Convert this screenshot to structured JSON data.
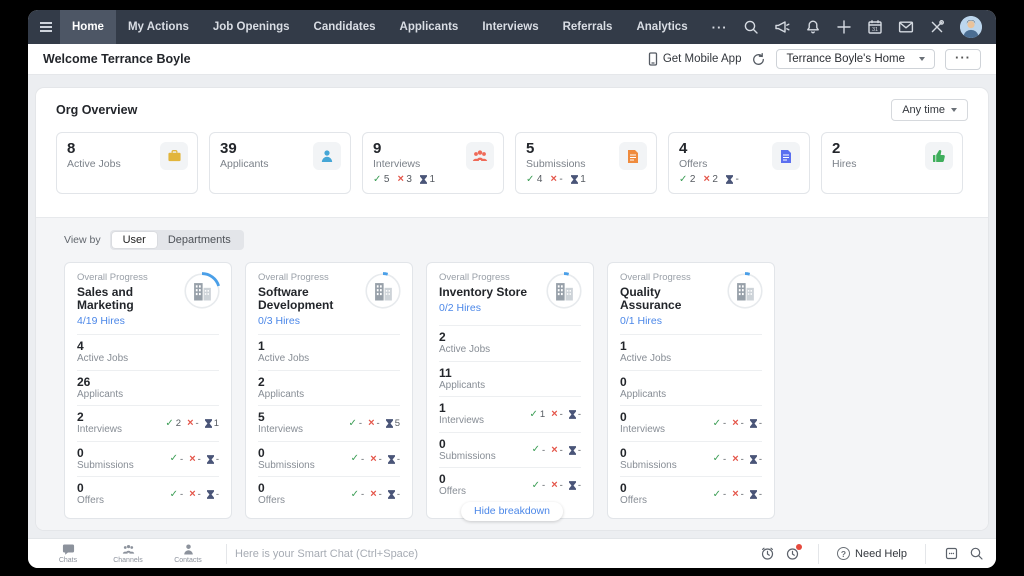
{
  "topnav": {
    "tabs": [
      "Home",
      "My Actions",
      "Job Openings",
      "Candidates",
      "Applicants",
      "Interviews",
      "Referrals",
      "Analytics"
    ],
    "more_label": "···",
    "calendar_day": "31",
    "icon_names": [
      "search-icon",
      "announcement-icon",
      "notifications-icon",
      "add-icon",
      "calendar-icon",
      "mail-icon",
      "setup-icon",
      "user-avatar"
    ]
  },
  "header": {
    "welcome_title": "Welcome Terrance Boyle",
    "get_mobile_app_label": "Get Mobile App",
    "dashboard_selector": "Terrance Boyle's Home",
    "more_label": "···"
  },
  "org": {
    "title": "Org Overview",
    "time_filter_label": "Any time",
    "cards": [
      {
        "value": "8",
        "label": "Active Jobs",
        "icon": "briefcase-icon"
      },
      {
        "value": "39",
        "label": "Applicants",
        "icon": "person-icon"
      },
      {
        "value": "9",
        "label": "Interviews",
        "icon": "group-icon",
        "ok": "5",
        "no": "3",
        "wait": "1"
      },
      {
        "value": "5",
        "label": "Submissions",
        "icon": "document-orange-icon",
        "ok": "4",
        "no": "-",
        "wait": "1"
      },
      {
        "value": "4",
        "label": "Offers",
        "icon": "document-blue-icon",
        "ok": "2",
        "no": "2",
        "wait": "-"
      },
      {
        "value": "2",
        "label": "Hires",
        "icon": "thumbs-up-icon"
      }
    ]
  },
  "view_by": {
    "label": "View by",
    "options": [
      "User",
      "Departments"
    ],
    "selected": "User"
  },
  "overall_progress_label": "Overall Progress",
  "departments": [
    {
      "name": "Sales and Marketing",
      "hires": "4/19 Hires",
      "arc_dash": "14 69",
      "rows": [
        {
          "value": "4",
          "label": "Active Jobs"
        },
        {
          "value": "26",
          "label": "Applicants"
        },
        {
          "value": "2",
          "label": "Interviews",
          "ok": "2",
          "no": "-",
          "wait": "1"
        },
        {
          "value": "0",
          "label": "Submissions",
          "ok": "-",
          "no": "-",
          "wait": "-"
        },
        {
          "value": "0",
          "label": "Offers",
          "ok": "-",
          "no": "-",
          "wait": "-"
        }
      ]
    },
    {
      "name": "Software Development",
      "hires": "0/3 Hires",
      "arc_dash": "3 69",
      "rows": [
        {
          "value": "1",
          "label": "Active Jobs"
        },
        {
          "value": "2",
          "label": "Applicants"
        },
        {
          "value": "5",
          "label": "Interviews",
          "ok": "-",
          "no": "-",
          "wait": "5"
        },
        {
          "value": "0",
          "label": "Submissions",
          "ok": "-",
          "no": "-",
          "wait": "-"
        },
        {
          "value": "0",
          "label": "Offers",
          "ok": "-",
          "no": "-",
          "wait": "-"
        }
      ]
    },
    {
      "name": "Inventory Store",
      "hires": "0/2 Hires",
      "arc_dash": "3 69",
      "rows": [
        {
          "value": "2",
          "label": "Active Jobs"
        },
        {
          "value": "11",
          "label": "Applicants"
        },
        {
          "value": "1",
          "label": "Interviews",
          "ok": "1",
          "no": "-",
          "wait": "-"
        },
        {
          "value": "0",
          "label": "Submissions",
          "ok": "-",
          "no": "-",
          "wait": "-"
        },
        {
          "value": "0",
          "label": "Offers",
          "ok": "-",
          "no": "-",
          "wait": "-"
        }
      ]
    },
    {
      "name": "Quality Assurance",
      "hires": "0/1 Hires",
      "arc_dash": "3 69",
      "rows": [
        {
          "value": "1",
          "label": "Active Jobs"
        },
        {
          "value": "0",
          "label": "Applicants"
        },
        {
          "value": "0",
          "label": "Interviews",
          "ok": "-",
          "no": "-",
          "wait": "-"
        },
        {
          "value": "0",
          "label": "Submissions",
          "ok": "-",
          "no": "-",
          "wait": "-"
        },
        {
          "value": "0",
          "label": "Offers",
          "ok": "-",
          "no": "-",
          "wait": "-"
        }
      ]
    }
  ],
  "breakdown_toggle_label": "Hide breakdown",
  "footer": {
    "chats_label": "Chats",
    "channels_label": "Channels",
    "contacts_label": "Contacts",
    "chat_placeholder": "Here is your Smart Chat (Ctrl+Space)",
    "need_help_label": "Need Help",
    "help_icon_glyph": "?"
  },
  "colors": {
    "navbar_bg": "#333b48",
    "accent_blue": "#4b87e8",
    "success_green": "#3d9e56",
    "danger_red": "#e4564a",
    "pending_navy": "#4a5578",
    "active_jobs_yellow": "#e2b53b",
    "applicants_blue": "#45a6d6",
    "interviews_coral": "#ef6a58",
    "submissions_orange": "#ef8b3e",
    "offers_blue": "#5b6ff0",
    "hires_green": "#3fae5c"
  }
}
